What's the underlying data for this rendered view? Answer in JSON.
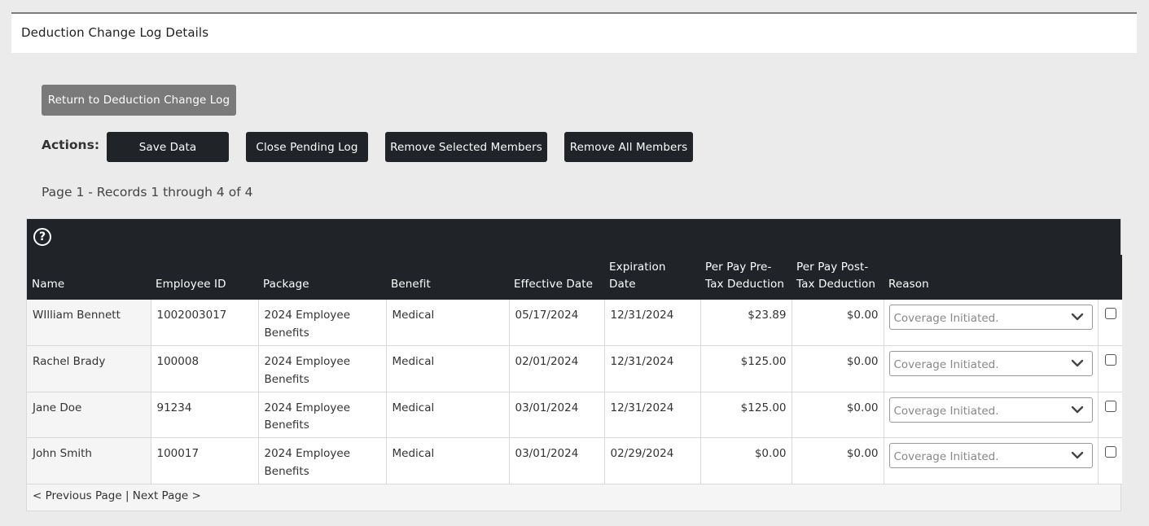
{
  "header": {
    "title": "Deduction Change Log Details"
  },
  "buttons": {
    "return": "Return to Deduction Change Log",
    "save": "Save Data",
    "close_pending": "Close Pending Log",
    "remove_selected": "Remove Selected Members",
    "remove_all": "Remove All Members"
  },
  "actions_label": "Actions:",
  "page_info": "Page 1 - Records 1 through 4 of 4",
  "grid": {
    "help_icon": "question-circle-icon",
    "columns": {
      "name": "Name",
      "employee_id": "Employee ID",
      "package": "Package",
      "benefit": "Benefit",
      "effective_date": "Effective Date",
      "expiration_date": "Expiration Date",
      "pre_tax": "Per Pay Pre-Tax Deduction",
      "post_tax": "Per Pay Post-Tax Deduction",
      "reason": "Reason"
    },
    "rows": [
      {
        "name": "WIlliam Bennett",
        "employee_id": "1002003017",
        "package": "2024 Employee Benefits",
        "benefit": "Medical",
        "effective_date": "05/17/2024",
        "expiration_date": "12/31/2024",
        "pre_tax": "$23.89",
        "post_tax": "$0.00",
        "reason": "Coverage Initiated."
      },
      {
        "name": "Rachel Brady",
        "employee_id": "100008",
        "package": "2024 Employee Benefits",
        "benefit": "Medical",
        "effective_date": "02/01/2024",
        "expiration_date": "12/31/2024",
        "pre_tax": "$125.00",
        "post_tax": "$0.00",
        "reason": "Coverage Initiated."
      },
      {
        "name": "Jane Doe",
        "employee_id": "91234",
        "package": "2024 Employee Benefits",
        "benefit": "Medical",
        "effective_date": "03/01/2024",
        "expiration_date": "12/31/2024",
        "pre_tax": "$125.00",
        "post_tax": "$0.00",
        "reason": "Coverage Initiated."
      },
      {
        "name": "John Smith",
        "employee_id": "100017",
        "package": "2024 Employee Benefits",
        "benefit": "Medical",
        "effective_date": "03/01/2024",
        "expiration_date": "02/29/2024",
        "pre_tax": "$0.00",
        "post_tax": "$0.00",
        "reason": "Coverage Initiated."
      }
    ]
  },
  "pager": {
    "previous": "< Previous Page",
    "separator": "|",
    "next": "Next Page >"
  },
  "colors": {
    "dark": "#202327",
    "return_button": "#7a7a7a",
    "page_bg": "#ebebeb"
  }
}
